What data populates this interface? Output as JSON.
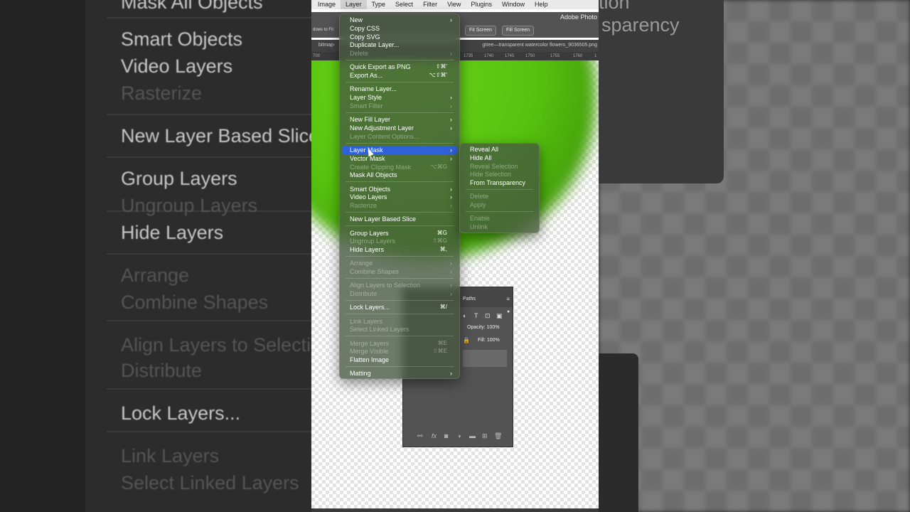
{
  "background": {
    "left_texts": [
      {
        "label": "Mask All Objects",
        "dim": false
      },
      {
        "label": "Smart Objects",
        "dim": false
      },
      {
        "label": "Video Layers",
        "dim": false
      },
      {
        "label": "Rasterize",
        "dim": true
      },
      {
        "label": "New Layer Based Slice",
        "dim": false
      },
      {
        "label": "Group Layers",
        "dim": false
      },
      {
        "label": "Ungroup Layers",
        "dim": true
      },
      {
        "label": "Hide Layers",
        "dim": false
      },
      {
        "label": "Arrange",
        "dim": true
      },
      {
        "label": "Combine Shapes",
        "dim": true
      },
      {
        "label": "Align Layers to Selection",
        "dim": true
      },
      {
        "label": "Distribute",
        "dim": true
      },
      {
        "label": "Lock Layers...",
        "dim": false
      },
      {
        "label": "Link Layers",
        "dim": true
      },
      {
        "label": "Select Linked Layers",
        "dim": true
      }
    ],
    "right_texts": [
      "tion",
      "sparency"
    ]
  },
  "menubar": {
    "items": [
      "Image",
      "Layer",
      "Type",
      "Select",
      "Filter",
      "View",
      "Plugins",
      "Window",
      "Help"
    ],
    "active": "Layer"
  },
  "app_title": "Adobe Photo",
  "options_bar": {
    "left_text": "dows to Fit",
    "fit_screen": "Fit Screen",
    "fill_screen": "Fill Screen"
  },
  "tabs": {
    "left": "bitmap-",
    "right": "gtree—transparent watercolor flowers_9036505.png"
  },
  "ruler": [
    "700",
    "1735",
    "1740",
    "1745",
    "1750",
    "1755",
    "1760",
    "1"
  ],
  "layers_panel": {
    "tab": "Paths",
    "opacity_label": "Opacity: 100%",
    "fill_label": "Fill: 100%",
    "header_icons": [
      "adjust-icon",
      "type-icon",
      "transform-icon",
      "smart-object-icon"
    ],
    "footer_icons": [
      "link-icon",
      "fx-icon",
      "mask-icon",
      "adjustment-icon",
      "folder-icon",
      "new-layer-icon",
      "trash-icon"
    ]
  },
  "layer_menu": {
    "items": [
      {
        "label": "New",
        "submenu": true
      },
      {
        "label": "Copy CSS"
      },
      {
        "label": "Copy SVG"
      },
      {
        "label": "Duplicate Layer..."
      },
      {
        "label": "Delete",
        "disabled": true,
        "submenu": true
      },
      {
        "sep": true
      },
      {
        "label": "Quick Export as PNG",
        "shortcut": "⇧⌘'"
      },
      {
        "label": "Export As...",
        "shortcut": "⌥⇧⌘'"
      },
      {
        "sep": true
      },
      {
        "label": "Rename Layer..."
      },
      {
        "label": "Layer Style",
        "submenu": true
      },
      {
        "label": "Smart Filter",
        "disabled": true,
        "submenu": true
      },
      {
        "sep": true
      },
      {
        "label": "New Fill Layer",
        "submenu": true
      },
      {
        "label": "New Adjustment Layer",
        "submenu": true
      },
      {
        "label": "Layer Content Options...",
        "disabled": true
      },
      {
        "sep": true
      },
      {
        "label": "Layer Mask",
        "submenu": true,
        "highlight": true
      },
      {
        "label": "Vector Mask",
        "submenu": true
      },
      {
        "label": "Create Clipping Mask",
        "disabled": true,
        "shortcut": "⌥⌘G"
      },
      {
        "label": "Mask All Objects"
      },
      {
        "sep": true
      },
      {
        "label": "Smart Objects",
        "submenu": true
      },
      {
        "label": "Video Layers",
        "submenu": true
      },
      {
        "label": "Rasterize",
        "disabled": true,
        "submenu": true
      },
      {
        "sep": true
      },
      {
        "label": "New Layer Based Slice"
      },
      {
        "sep": true
      },
      {
        "label": "Group Layers",
        "shortcut": "⌘G"
      },
      {
        "label": "Ungroup Layers",
        "disabled": true,
        "shortcut": "⇧⌘G"
      },
      {
        "label": "Hide Layers",
        "shortcut": "⌘,"
      },
      {
        "sep": true
      },
      {
        "label": "Arrange",
        "disabled": true,
        "submenu": true
      },
      {
        "label": "Combine Shapes",
        "disabled": true,
        "submenu": true
      },
      {
        "sep": true
      },
      {
        "label": "Align Layers to Selection",
        "disabled": true,
        "submenu": true
      },
      {
        "label": "Distribute",
        "disabled": true,
        "submenu": true
      },
      {
        "sep": true
      },
      {
        "label": "Lock Layers...",
        "shortcut": "⌘/"
      },
      {
        "sep": true
      },
      {
        "label": "Link Layers",
        "disabled": true
      },
      {
        "label": "Select Linked Layers",
        "disabled": true
      },
      {
        "sep": true
      },
      {
        "label": "Merge Layers",
        "disabled": true,
        "shortcut": "⌘E"
      },
      {
        "label": "Merge Visible",
        "disabled": true,
        "shortcut": "⇧⌘E"
      },
      {
        "label": "Flatten Image"
      },
      {
        "sep": true
      },
      {
        "label": "Matting",
        "submenu": true
      }
    ]
  },
  "mask_submenu": {
    "items": [
      {
        "label": "Reveal All"
      },
      {
        "label": "Hide All"
      },
      {
        "label": "Reveal Selection",
        "disabled": true
      },
      {
        "label": "Hide Selection",
        "disabled": true
      },
      {
        "label": "From Transparency"
      },
      {
        "sep": true
      },
      {
        "label": "Delete",
        "disabled": true
      },
      {
        "label": "Apply",
        "disabled": true
      },
      {
        "sep": true
      },
      {
        "label": "Enable",
        "disabled": true
      },
      {
        "label": "Unlink",
        "disabled": true
      }
    ]
  },
  "colors": {
    "highlight": "#2f62d9",
    "leaf_green": "#5ac612"
  }
}
